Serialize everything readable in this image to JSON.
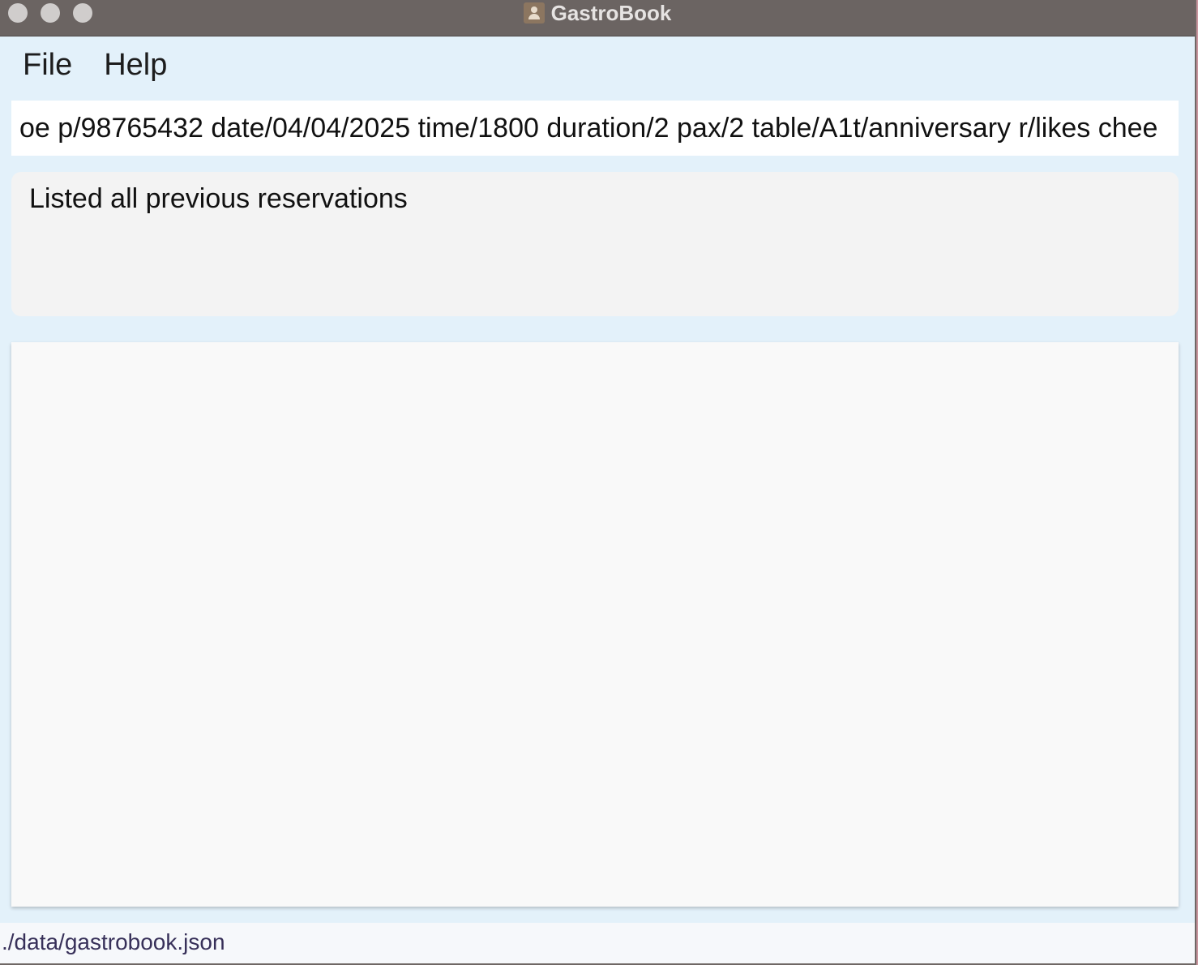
{
  "window": {
    "title": "GastroBook"
  },
  "menu": {
    "items": [
      "File",
      "Help"
    ]
  },
  "command": {
    "value": "oe p/98765432 date/04/04/2025 time/1800 duration/2 pax/2 table/A1t/anniversary r/likes chee"
  },
  "result": {
    "message": "Listed all previous reservations"
  },
  "reservation_list": {
    "items": []
  },
  "status": {
    "file_path": "./data/gastrobook.json"
  }
}
